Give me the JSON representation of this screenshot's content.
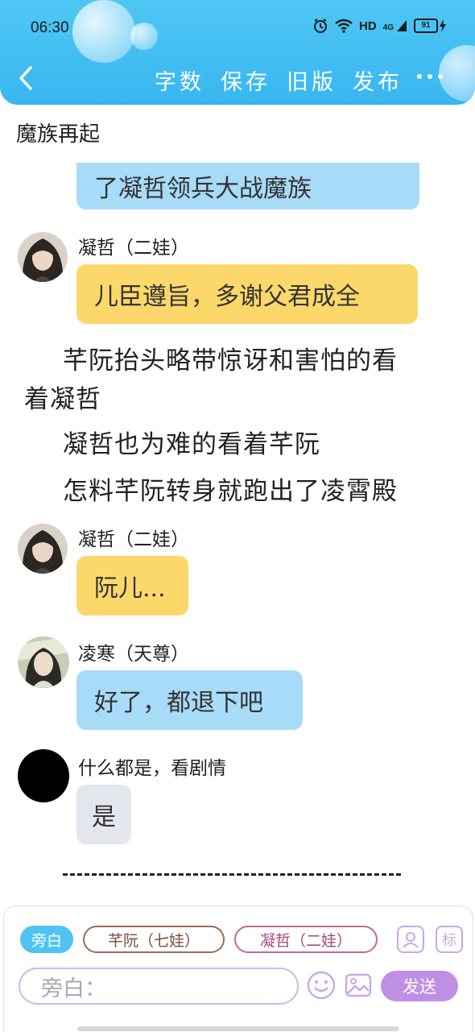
{
  "status": {
    "time": "06:30",
    "network": "HD",
    "signal": "4G",
    "battery": "91"
  },
  "toolbar": {
    "word_count": "字数",
    "save": "保存",
    "old_version": "旧版",
    "publish": "发布"
  },
  "chapter": {
    "title": "魔族再起"
  },
  "messages": {
    "m0": "了凝哲领兵大战魔族",
    "m1_speaker": "凝哲（二娃）",
    "m1_text": "儿臣遵旨，多谢父君成全",
    "n1a": "芊阮抬头略带惊讶和害怕的看",
    "n1b": "着凝哲",
    "n2": "凝哲也为难的看着芊阮",
    "n3": "怎料芊阮转身就跑出了凌霄殿",
    "m2_speaker": "凝哲（二娃）",
    "m2_text": "阮儿...",
    "m3_speaker": "凌寒（天尊）",
    "m3_text": "好了，都退下吧",
    "m4_speaker": "什么都是，看剧情",
    "m4_text": "是",
    "divider": "——————————————"
  },
  "composer": {
    "chip_narration": "旁白",
    "chip_role1": "芊阮（七娃）",
    "chip_role2": "凝哲（二娃）",
    "input_placeholder": "旁白：",
    "send": "发送",
    "tag_icon_label": "标"
  },
  "colors": {
    "header": "#39b6f0",
    "bubble_blue": "#a7dbf8",
    "bubble_yellow": "#fcd86a",
    "bubble_grey": "#e3e6ec",
    "send_purple": "#bf8fe6"
  }
}
